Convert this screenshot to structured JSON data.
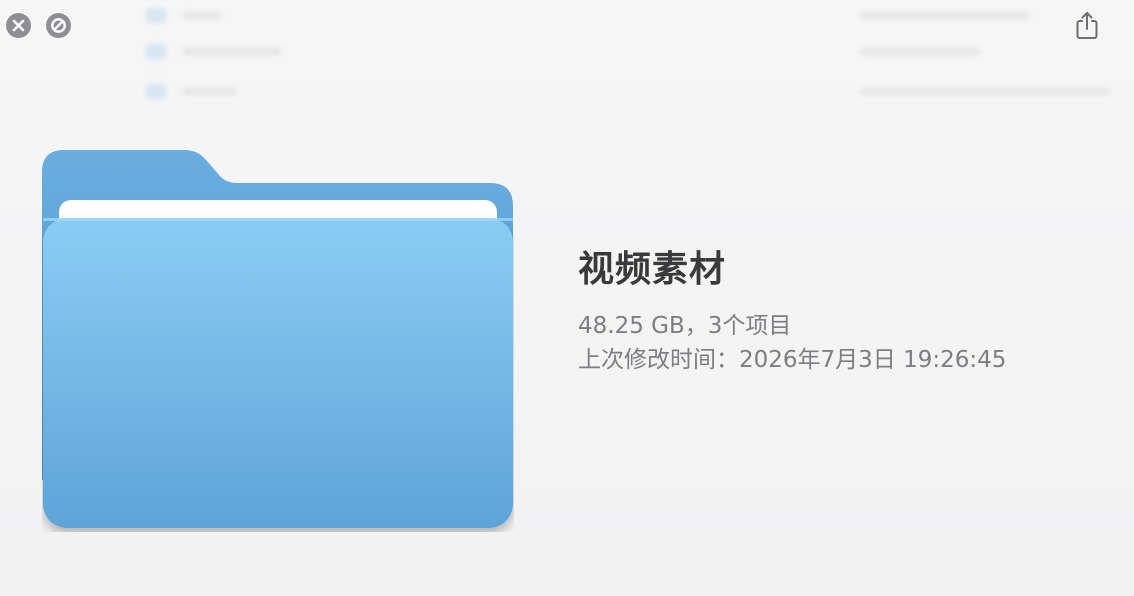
{
  "window": {
    "title": "视频素材"
  },
  "toolbar": {
    "close_icon": "close-icon",
    "fullscreen_icon": "fullscreen-icon",
    "share_icon": "share-icon"
  },
  "file": {
    "name": "视频素材",
    "size_and_count": "48.25 GB，3个项目",
    "modified": "上次修改时间：2026年7月3日 19:26:45",
    "icon": "folder-icon"
  },
  "colors": {
    "folder_front": "#7bbde8",
    "folder_back": "#5fa3d8",
    "title_text": "#3a3a3c",
    "secondary_text": "#7d7d82"
  }
}
